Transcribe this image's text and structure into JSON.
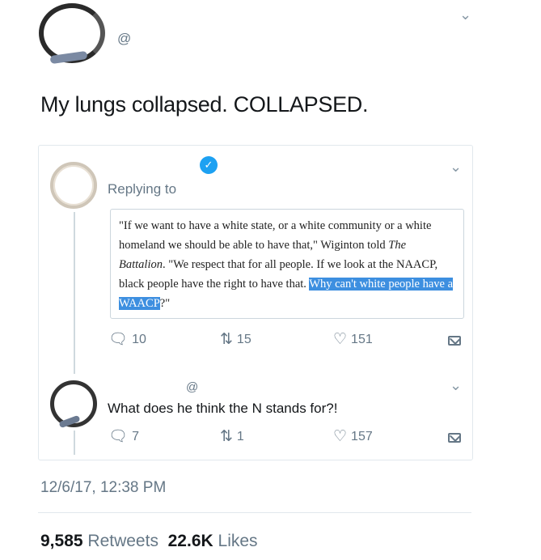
{
  "main_tweet": {
    "handle": "@",
    "text": "My lungs collapsed. COLLAPSED.",
    "timestamp": "12/6/17, 12:38 PM",
    "retweets_count": "9,585",
    "retweets_label": "Retweets",
    "likes_count": "22.6K",
    "likes_label": "Likes"
  },
  "reply1": {
    "replying_label": "Replying to",
    "quote_text_before": "\"If we want to have a white state, or a white community or a white homeland we should be able to have that,\" Wiginton told ",
    "quote_italic": "The Battalion",
    "quote_text_middle": ". \"We respect that for all people. If we look at the NAACP, black people have the right to have that. ",
    "quote_highlight": "Why can't white people have a WAACP",
    "quote_text_after": "?\"",
    "reply_count": "10",
    "retweet_count": "15",
    "like_count": "151"
  },
  "reply2": {
    "handle": "@",
    "text": "What does he think the N stands for?!",
    "reply_count": "7",
    "retweet_count": "1",
    "like_count": "157"
  },
  "colors": {
    "accent": "#1da1f2",
    "highlight": "#3d8fe0",
    "muted": "#657786"
  },
  "icons": {
    "reply": "speech-bubble-icon",
    "retweet": "retweet-icon",
    "like": "heart-icon",
    "dm": "envelope-icon",
    "caret": "chevron-down-icon",
    "verified": "verified-badge-icon"
  }
}
